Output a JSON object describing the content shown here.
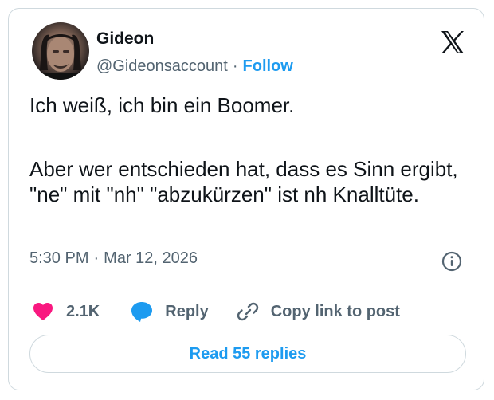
{
  "author": {
    "name": "Gideon",
    "handle": "@Gideonsaccount",
    "follow_label": "Follow"
  },
  "tweet": {
    "line1": "Ich weiß, ich bin ein Boomer.",
    "line2": "Aber wer entschieden hat, dass es Sinn ergibt, \"ne\" mit \"nh\" \"abzukürzen\" ist nh Knalltüte."
  },
  "meta": {
    "time": "5:30 PM",
    "date": "Mar 12, 2026"
  },
  "actions": {
    "like_count": "2.1K",
    "reply_label": "Reply",
    "copy_label": "Copy link to post"
  },
  "read_replies_label": "Read 55 replies",
  "colors": {
    "accent": "#1d9bf0",
    "like": "#f91880",
    "text": "#0f1419",
    "muted": "#536471",
    "border": "#cfd9de"
  },
  "icons": [
    "x-logo-icon",
    "info-icon",
    "heart-icon",
    "reply-bubble-icon",
    "link-icon"
  ]
}
